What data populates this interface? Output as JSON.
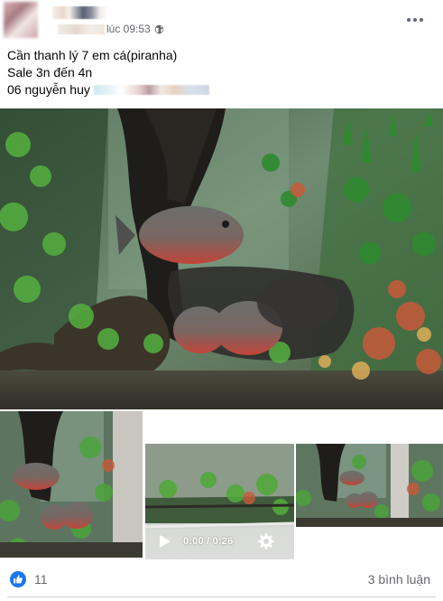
{
  "post": {
    "timestamp": "lúc 09:53",
    "privacy_icon": "globe-icon",
    "more_icon": "more-options-icon",
    "text_lines": [
      "Cần thanh lý 7 em cá(piranha)",
      "Sale 3n đến 4n",
      "06 nguyễn huy"
    ]
  },
  "media": {
    "video": {
      "time": "0:00 / 0:26",
      "play_icon": "play-icon",
      "settings_icon": "gear-icon"
    }
  },
  "reactions": {
    "like_icon": "like-icon",
    "count": "11",
    "comments": "3 bình luận"
  },
  "colors": {
    "meta_text": "#65676b",
    "facebook_blue": "#1877f2",
    "divider": "#ced0d4"
  }
}
